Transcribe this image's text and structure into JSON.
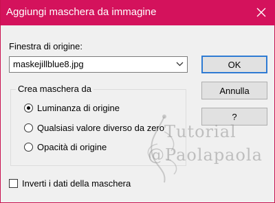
{
  "window": {
    "title": "Aggiungi maschera da immagine",
    "title_bar_color": "#d4125c"
  },
  "source": {
    "label": "Finestra di origine:",
    "selected": "maskejillblue8.jpg"
  },
  "buttons": {
    "ok": "OK",
    "cancel": "Annulla",
    "help": "?"
  },
  "group": {
    "label": "Crea maschera da",
    "options": [
      {
        "label": "Luminanza di origine",
        "checked": true
      },
      {
        "label": "Qualsiasi valore diverso da zero",
        "checked": false
      },
      {
        "label": "Opacità di origine",
        "checked": false
      }
    ]
  },
  "invert": {
    "label": "Inverti i dati della maschera",
    "checked": false
  },
  "watermark": {
    "line1": "Tutorial",
    "line2": "@Paolapaola"
  }
}
